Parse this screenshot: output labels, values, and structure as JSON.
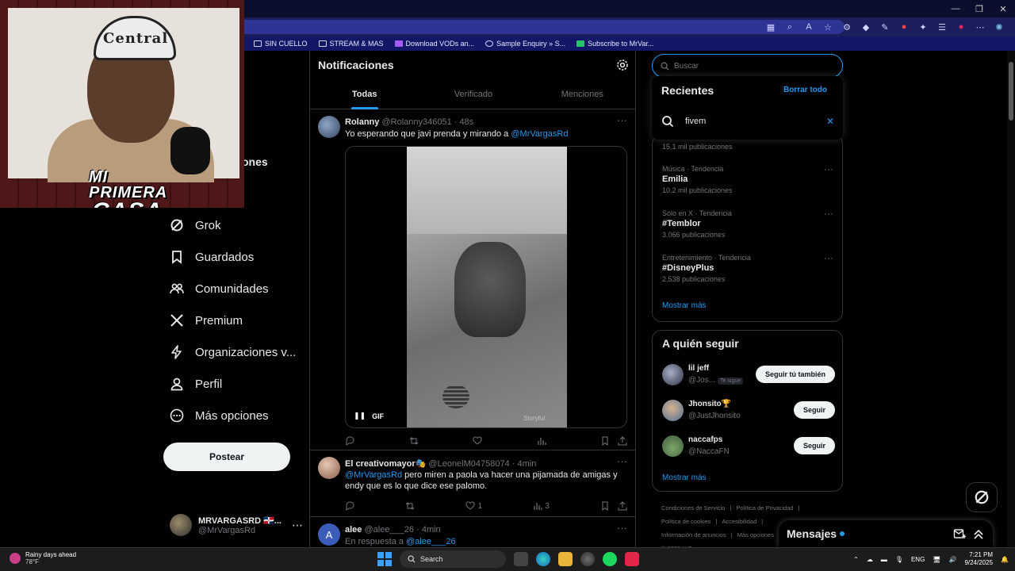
{
  "browser": {
    "bookmarks": [
      "SIN CUELLO",
      "STREAM & MAS",
      "Download VODs an...",
      "Sample Enquiry » S...",
      "Subscribe to MrVar..."
    ]
  },
  "overlay": {
    "cap_text": "Central",
    "logo_line1": "MI PRIMERA",
    "logo_line2": "CASA"
  },
  "nav": {
    "partial_label": "ones",
    "items": [
      {
        "label": "Grok",
        "icon": "grok-icon"
      },
      {
        "label": "Guardados",
        "icon": "bookmark-icon"
      },
      {
        "label": "Comunidades",
        "icon": "communities-icon"
      },
      {
        "label": "Premium",
        "icon": "x-logo-icon"
      },
      {
        "label": "Organizaciones v...",
        "icon": "lightning-icon"
      },
      {
        "label": "Perfil",
        "icon": "person-icon"
      },
      {
        "label": "Más opciones",
        "icon": "more-circle-icon"
      }
    ],
    "post_button": "Postear",
    "account": {
      "name": "MRVARGASRD 🇩🇴...",
      "handle": "@MrVargasRd"
    }
  },
  "center": {
    "title": "Notificaciones",
    "tabs": [
      "Todas",
      "Verificado",
      "Menciones"
    ],
    "active_tab": "Todas",
    "posts": [
      {
        "name": "Rolanny",
        "handle": "@Rolanny346051",
        "time": "· 48s",
        "text": "Yo esperando que javi prenda y mirando a ",
        "mention": "@MrVargasRd",
        "media_badge": "GIF",
        "watermark": "Storyful"
      },
      {
        "name": "El creativomayor🎭",
        "handle": "@LeonelM04758074",
        "time": "· 4min",
        "mention": "@MrVargasRd",
        "text": " pero miren a paola va hacer una pijamada de amigas y endy que es lo que dice ese palomo.",
        "likes": "1",
        "views": "3"
      },
      {
        "name": "alee",
        "handle": "@alee___26",
        "time": "· 4min",
        "reply_prefix": "En respuesta a ",
        "reply_to": "@alee___26"
      }
    ]
  },
  "search": {
    "placeholder": "Buscar",
    "recent_title": "Recientes",
    "clear_all": "Borrar todo",
    "recent_query": "fivem"
  },
  "trends": {
    "first_count": "15,1 mil publicaciones",
    "items": [
      {
        "category": "Música · Tendencia",
        "title": "Emilia",
        "count": "10,2 mil publicaciones"
      },
      {
        "category": "Solo en X · Tendencia",
        "title": "#Temblor",
        "count": "3.066 publicaciones"
      },
      {
        "category": "Entretenimiento · Tendencia",
        "title": "#DisneyPlus",
        "count": "2.538 publicaciones"
      }
    ],
    "show_more": "Mostrar más"
  },
  "who_to_follow": {
    "title": "A quién seguir",
    "users": [
      {
        "name": "lil jeff",
        "handle": "@Jos...",
        "follows_you": "Te sigue",
        "button": "Seguir tú también"
      },
      {
        "name": "Jhonsito🏆",
        "handle": "@JustJhonsito",
        "button": "Seguir"
      },
      {
        "name": "naccafps",
        "handle": "@NaccaFN",
        "button": "Seguir"
      }
    ],
    "show_more": "Mostrar más"
  },
  "footer": {
    "links": [
      "Condiciones de Servicio",
      "|",
      "Política de Privacidad",
      "|",
      "Política de cookies",
      "|",
      "Accesibilidad",
      "|",
      "Información de anuncios",
      "|",
      "Más opciones",
      "© 2025 X Corp."
    ]
  },
  "messages": {
    "title": "Mensajes"
  },
  "taskbar": {
    "weather_line1": "Rainy days ahead",
    "weather_line2": "78°F",
    "search": "Search",
    "lang": "ENG",
    "time": "7:21 PM",
    "date": "9/24/2025"
  },
  "colors": {
    "accent": "#1d9bf0",
    "background": "#000000",
    "border": "#2f3336",
    "muted": "#71767b"
  }
}
